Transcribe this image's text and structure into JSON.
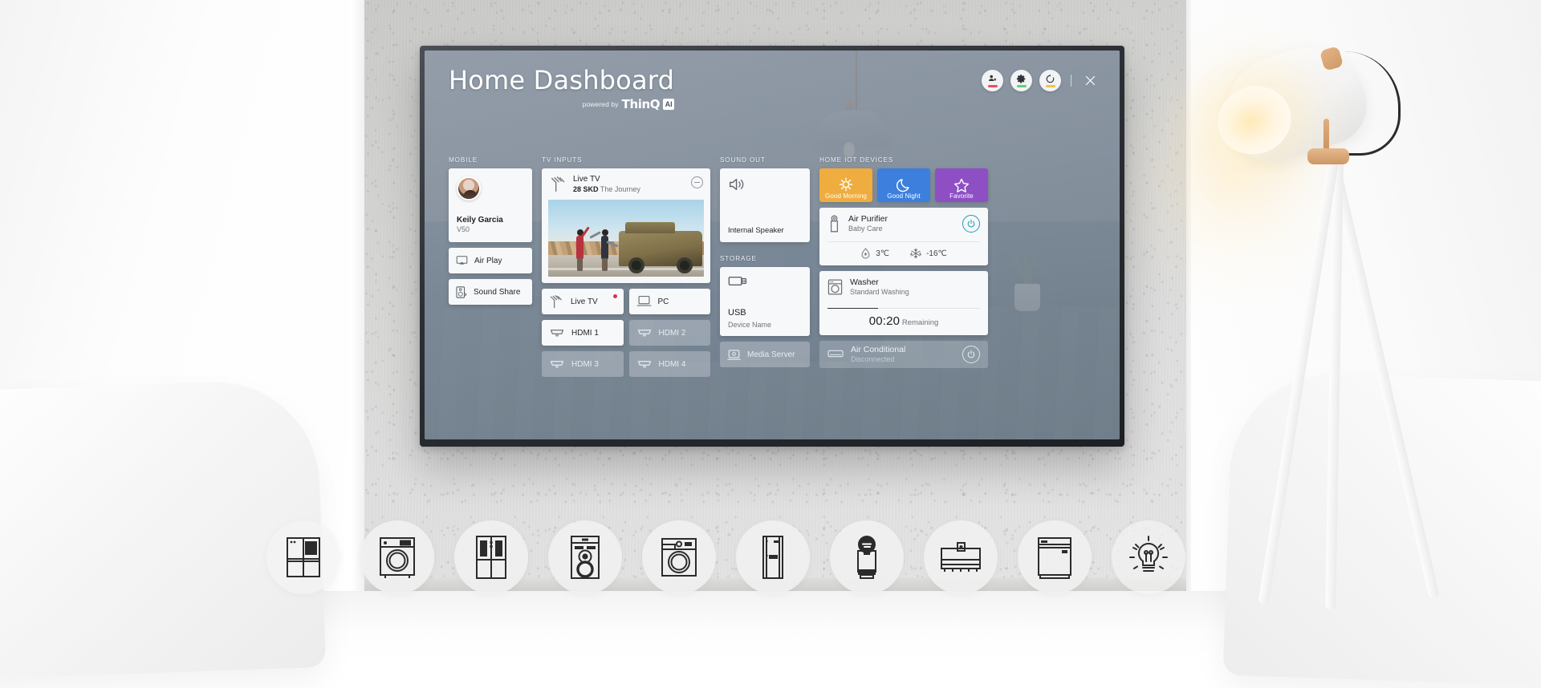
{
  "scene": {
    "description": "LG TV mounted on concrete wall in bright living room showing Home Dashboard UI",
    "room_objects": [
      "white-armchair-left",
      "white-armchair-right",
      "tripod-floor-lamp",
      "concrete-accent-wall"
    ]
  },
  "header": {
    "title": "Home Dashboard",
    "powered_by": "powered by",
    "brand": "ThinQ",
    "brand_badge": "AI",
    "actions": [
      {
        "name": "user-profile-button",
        "icon": "user-star-icon",
        "underline_color": "#e8505b"
      },
      {
        "name": "settings-button",
        "icon": "gear-icon",
        "underline_color": "#5fd07a"
      },
      {
        "name": "refresh-button",
        "icon": "refresh-icon",
        "underline_color": "#f3c53e"
      }
    ],
    "close_label": "×"
  },
  "mobile": {
    "label": "MOBILE",
    "profile": {
      "name": "Keily Garcia",
      "model": "V50",
      "avatar": "user-photo"
    },
    "buttons": [
      {
        "label": "Air Play",
        "icon": "airplay-icon"
      },
      {
        "label": "Sound Share",
        "icon": "speaker-share-icon"
      }
    ]
  },
  "tv_inputs": {
    "label": "TV INPUTS",
    "current": {
      "title": "Live TV",
      "channel": "28 SKD",
      "program": "The Journey",
      "icon": "antenna-icon",
      "remove_label": "−",
      "thumbnail": "two-people-dancing-beside-offroad-vehicle"
    },
    "tiles": [
      {
        "label": "Live TV",
        "icon": "antenna-icon",
        "active": true,
        "badge": true,
        "dimmed": false
      },
      {
        "label": "PC",
        "icon": "laptop-icon",
        "active": false,
        "badge": false,
        "dimmed": false
      },
      {
        "label": "HDMI 1",
        "icon": "hdmi-icon",
        "active": false,
        "badge": false,
        "dimmed": false
      },
      {
        "label": "HDMI 2",
        "icon": "hdmi-icon",
        "active": false,
        "badge": false,
        "dimmed": true
      },
      {
        "label": "HDMI 3",
        "icon": "hdmi-icon",
        "active": false,
        "badge": false,
        "dimmed": true
      },
      {
        "label": "HDMI 4",
        "icon": "hdmi-icon",
        "active": false,
        "badge": false,
        "dimmed": true
      }
    ]
  },
  "sound_out": {
    "label": "SOUND OUT",
    "device": "Internal Speaker",
    "icon": "speaker-volume-icon"
  },
  "storage": {
    "label": "STORAGE",
    "usb": {
      "title": "USB",
      "subtitle": "Device Name",
      "icon": "usb-drive-icon"
    },
    "media_server": {
      "label": "Media Server",
      "icon": "media-server-icon"
    }
  },
  "home_iot": {
    "label": "HOME IOT DEVICES",
    "scenes": [
      {
        "label": "Good Morning",
        "icon": "sun-icon",
        "color": "#eead3e"
      },
      {
        "label": "Good Night",
        "icon": "moon-icon",
        "color": "#3c7fdd"
      },
      {
        "label": "Favorite",
        "icon": "star-icon",
        "color": "#8e4fc4"
      }
    ],
    "devices": [
      {
        "name": "Air Purifier",
        "mode": "Baby Care",
        "icon": "air-purifier-icon",
        "power_on": true,
        "power_color": "#1f9bb5",
        "readings": [
          {
            "icon": "humidity-drop-icon",
            "value": "3℃"
          },
          {
            "icon": "snowflake-icon",
            "value": "-16℃"
          }
        ]
      },
      {
        "name": "Washer",
        "mode": "Standard Washing",
        "icon": "washer-icon",
        "progress_percent": 33,
        "time_remaining": "00:20",
        "time_label": "Remaining"
      },
      {
        "name": "Air Conditional",
        "mode": "Disconnected",
        "icon": "air-conditioner-icon",
        "power_on": false,
        "disabled": true
      }
    ]
  },
  "appliance_dock": [
    {
      "name": "refrigerator-icon",
      "faded": true
    },
    {
      "name": "washing-machine-icon",
      "faded": false
    },
    {
      "name": "side-by-side-refrigerator-icon",
      "faded": false
    },
    {
      "name": "air-purifier-tower-icon",
      "faded": false
    },
    {
      "name": "front-load-washer-icon",
      "faded": false
    },
    {
      "name": "air-conditioner-tower-icon",
      "faded": false
    },
    {
      "name": "robot-air-purifier-icon",
      "faded": false
    },
    {
      "name": "styler-icon",
      "faded": false
    },
    {
      "name": "dishwasher-icon",
      "faded": false
    },
    {
      "name": "light-bulb-icon",
      "faded": true
    }
  ],
  "colors": {
    "screen_bg": "#8d98a6",
    "card_bg": "#f7f8f9",
    "text_primary": "#1c1f22",
    "text_secondary": "#6d747b",
    "accent_teal": "#1f9bb5",
    "badge_red": "#e0304a"
  }
}
